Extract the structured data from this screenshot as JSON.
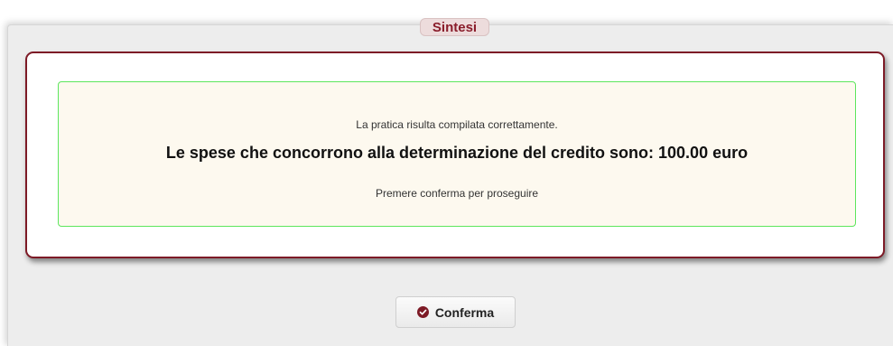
{
  "dialog": {
    "title": "Sintesi"
  },
  "summary": {
    "line1": "La pratica risulta compilata correttamente.",
    "line2": "Le spese che concorrono alla determinazione del credito sono: 100.00 euro",
    "line3": "Premere conferma per proseguire"
  },
  "actions": {
    "confirm_label": "Conferma",
    "confirm_icon": "check-circle-icon"
  },
  "colors": {
    "accent": "#7d1a26",
    "success_border": "#5de65d",
    "message_background": "#fdf9ef"
  }
}
